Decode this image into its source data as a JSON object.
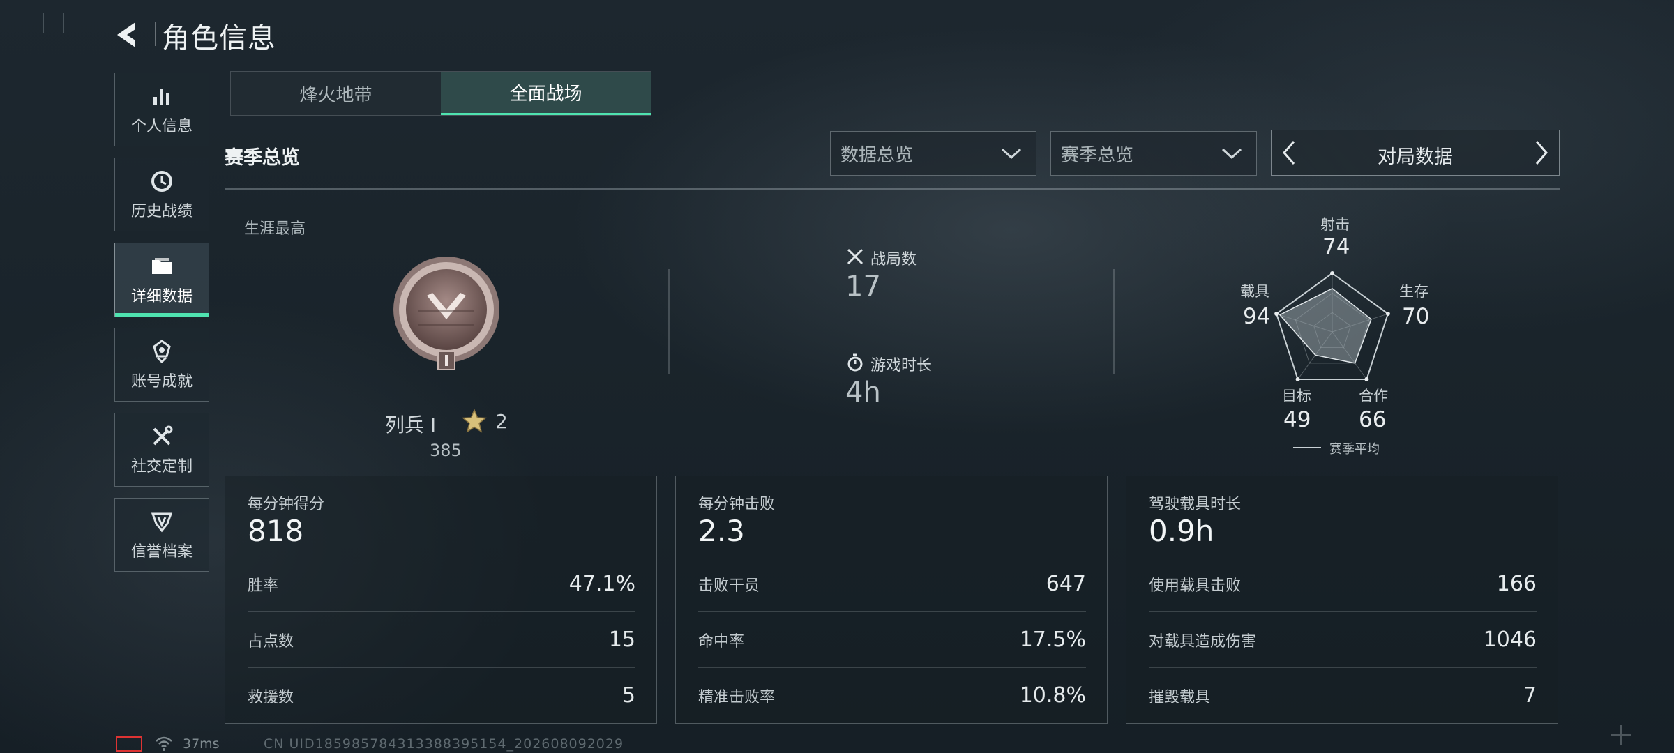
{
  "header": {
    "title": "角色信息"
  },
  "sidebar": {
    "items": [
      {
        "label": "个人信息",
        "icon": "bar-chart-icon"
      },
      {
        "label": "历史战绩",
        "icon": "clock-icon"
      },
      {
        "label": "详细数据",
        "icon": "folder-icon",
        "active": true
      },
      {
        "label": "账号成就",
        "icon": "medal-icon"
      },
      {
        "label": "社交定制",
        "icon": "tools-icon"
      },
      {
        "label": "信誉档案",
        "icon": "shield-icon"
      }
    ]
  },
  "tabs": [
    {
      "label": "烽火地带",
      "active": false
    },
    {
      "label": "全面战场",
      "active": true
    }
  ],
  "section": {
    "title": "赛季总览",
    "dropdowns": [
      "数据总览",
      "赛季总览"
    ],
    "pager_label": "对局数据"
  },
  "career": {
    "label": "生涯最高",
    "rank_name": "列兵 I",
    "stars": "2",
    "points": "385"
  },
  "summary": {
    "matches_label": "战局数",
    "matches_value": "17",
    "playtime_label": "游戏时长",
    "playtime_value": "4h"
  },
  "radar": {
    "axes": [
      {
        "label": "射击",
        "value": "74"
      },
      {
        "label": "生存",
        "value": "70"
      },
      {
        "label": "合作",
        "value": "66"
      },
      {
        "label": "目标",
        "value": "49"
      },
      {
        "label": "载具",
        "value": "94"
      }
    ],
    "legend": "赛季平均"
  },
  "cards": [
    {
      "head_label": "每分钟得分",
      "head_value": "818",
      "rows": [
        {
          "k": "胜率",
          "v": "47.1%"
        },
        {
          "k": "占点数",
          "v": "15"
        },
        {
          "k": "救援数",
          "v": "5"
        }
      ]
    },
    {
      "head_label": "每分钟击败",
      "head_value": "2.3",
      "rows": [
        {
          "k": "击败干员",
          "v": "647"
        },
        {
          "k": "命中率",
          "v": "17.5%"
        },
        {
          "k": "精准击败率",
          "v": "10.8%"
        }
      ]
    },
    {
      "head_label": "驾驶载具时长",
      "head_value": "0.9h",
      "rows": [
        {
          "k": "使用载具击败",
          "v": "166"
        },
        {
          "k": "对载具造成伤害",
          "v": "1046"
        },
        {
          "k": "摧毁载具",
          "v": "7"
        }
      ]
    }
  ],
  "status": {
    "ping": "37ms",
    "uid": "CN UID18598578431338839515​4_202608092029"
  },
  "colors": {
    "accent": "#4fe3b0",
    "battery_low": "#dd3333"
  }
}
